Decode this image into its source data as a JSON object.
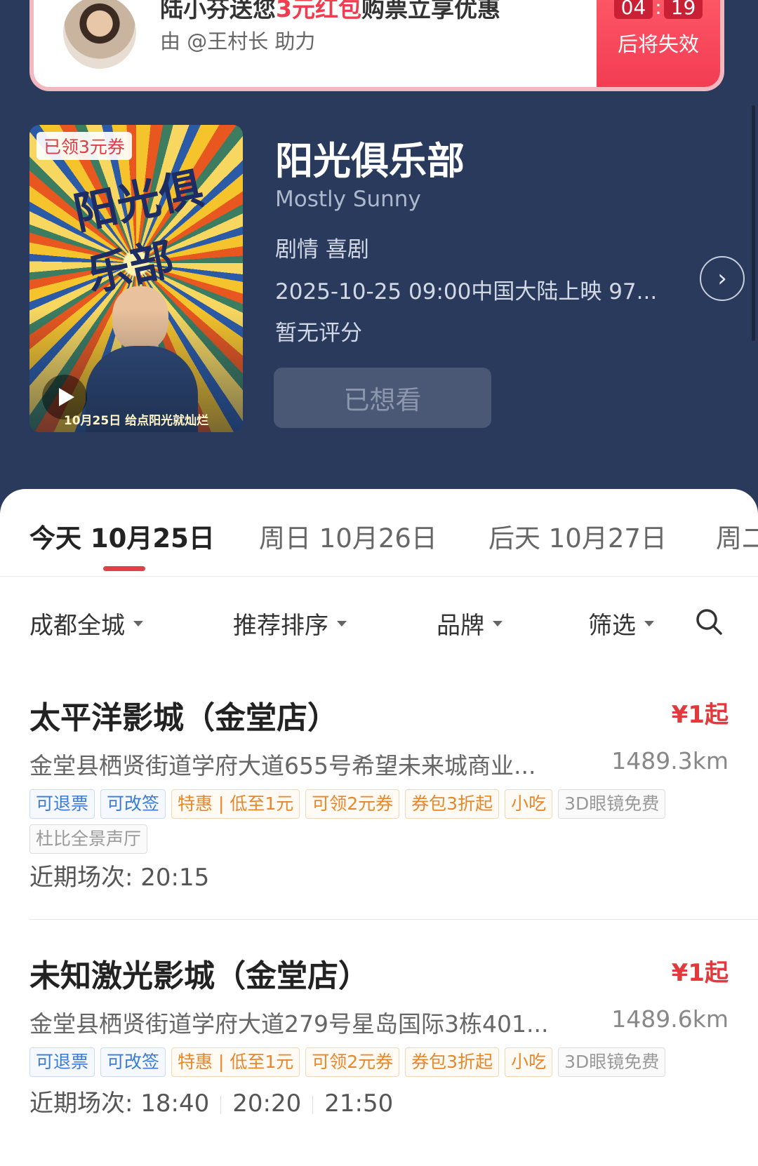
{
  "banner": {
    "title_prefix": "陆小芬送您",
    "title_highlight": "3元红包",
    "title_suffix": "购票立享优惠",
    "subtitle": "由 @王村长 助力",
    "countdown_min": "04",
    "countdown_sec": "19",
    "countdown_label": "后将失效"
  },
  "movie": {
    "title": "阳光俱乐部",
    "title_en": "Mostly Sunny",
    "genre": "剧情 喜剧",
    "release": "2025-10-25 09:00中国大陆上映 97...",
    "rating": "暂无评分",
    "want_button": "已想看",
    "poster": {
      "badge": "已领3元券",
      "calligraphy": "阳光俱乐部",
      "bottom_text": "10月25日 给点阳光就灿烂"
    }
  },
  "date_tabs": [
    {
      "label": "今天 10月25日",
      "active": true
    },
    {
      "label": "周日 10月26日",
      "active": false
    },
    {
      "label": "后天 10月27日",
      "active": false
    },
    {
      "label": "周二",
      "active": false
    }
  ],
  "filters": {
    "city": "成都全城",
    "sort": "推荐排序",
    "brand": "品牌",
    "filter": "筛选"
  },
  "cinemas": [
    {
      "name": "太平洋影城（金堂店）",
      "price": "¥1起",
      "address": "金堂县栖贤街道学府大道655号希望未来城商业...",
      "distance": "1489.3km",
      "tags": [
        {
          "text": "可退票",
          "style": "blue"
        },
        {
          "text": "可改签",
          "style": "blue"
        },
        {
          "text": "特惠 | 低至1元",
          "style": "orange"
        },
        {
          "text": "可领2元券",
          "style": "orange"
        },
        {
          "text": "券包3折起",
          "style": "orange"
        },
        {
          "text": "小吃",
          "style": "orange"
        },
        {
          "text": "3D眼镜免费",
          "style": "gray"
        },
        {
          "text": "杜比全景声厅",
          "style": "gray"
        }
      ],
      "showtimes_label": "近期场次: ",
      "showtimes": [
        "20:15"
      ]
    },
    {
      "name": "未知激光影城（金堂店）",
      "price": "¥1起",
      "address": "金堂县栖贤街道学府大道279号星岛国际3栋401...",
      "distance": "1489.6km",
      "tags": [
        {
          "text": "可退票",
          "style": "blue"
        },
        {
          "text": "可改签",
          "style": "blue"
        },
        {
          "text": "特惠 | 低至1元",
          "style": "orange"
        },
        {
          "text": "可领2元券",
          "style": "orange"
        },
        {
          "text": "券包3折起",
          "style": "orange"
        },
        {
          "text": "小吃",
          "style": "orange"
        },
        {
          "text": "3D眼镜免费",
          "style": "gray"
        }
      ],
      "showtimes_label": "近期场次: ",
      "showtimes": [
        "18:40",
        "20:20",
        "21:50"
      ]
    }
  ],
  "colors": {
    "header_bg": "#2a3a5c",
    "accent_red": "#e4393c",
    "tag_blue": "#3a7bd5",
    "tag_orange": "#e8872a"
  },
  "icons": [
    "play-icon",
    "chevron-right-icon",
    "caret-down-icon",
    "search-icon"
  ]
}
